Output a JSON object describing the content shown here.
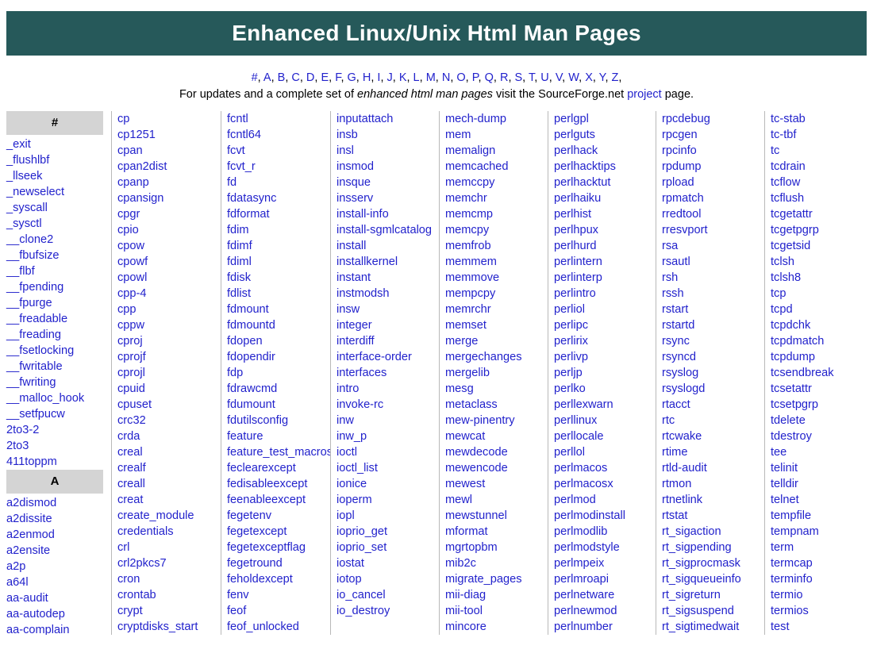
{
  "banner": {
    "title": "Enhanced Linux/Unix Html Man Pages",
    "background_color": "#26595a",
    "text_color": "#ffffff"
  },
  "nav": {
    "separator": ",",
    "link_color": "#2222cc",
    "letters": [
      "#",
      "A",
      "B",
      "C",
      "D",
      "E",
      "F",
      "G",
      "H",
      "I",
      "J",
      "K",
      "L",
      "M",
      "N",
      "O",
      "P",
      "Q",
      "R",
      "S",
      "T",
      "U",
      "V",
      "W",
      "X",
      "Y",
      "Z"
    ]
  },
  "blurb": {
    "part1": "For updates and a complete set of ",
    "emphasis": "enhanced html man pages",
    "part2": " visit the SourceForge.net ",
    "link": "project",
    "part3": " page."
  },
  "index": {
    "header_background": "#d4d4d4",
    "columns": [
      {
        "name": "column-1",
        "blocks": [
          {
            "type": "letter",
            "label": "#"
          },
          {
            "type": "entries",
            "items": [
              "_exit",
              "_flushlbf",
              "_llseek",
              "_newselect",
              "_syscall",
              "_sysctl",
              "__clone2",
              "__fbufsize",
              "__flbf",
              "__fpending",
              "__fpurge",
              "__freadable",
              "__freading",
              "__fsetlocking",
              "__fwritable",
              "__fwriting",
              "__malloc_hook",
              "__setfpucw",
              "2to3-2",
              "2to3",
              "411toppm"
            ]
          },
          {
            "type": "letter",
            "label": "A"
          },
          {
            "type": "entries",
            "items": [
              "a2dismod",
              "a2dissite",
              "a2enmod",
              "a2ensite",
              "a2p",
              "a64l",
              "aa-audit",
              "aa-autodep",
              "aa-complain"
            ]
          }
        ]
      },
      {
        "name": "column-2",
        "blocks": [
          {
            "type": "entries",
            "items": [
              "cp",
              "cp1251",
              "cpan",
              "cpan2dist",
              "cpanp",
              "cpansign",
              "cpgr",
              "cpio",
              "cpow",
              "cpowf",
              "cpowl",
              "cpp-4",
              "cpp",
              "cppw",
              "cproj",
              "cprojf",
              "cprojl",
              "cpuid",
              "cpuset",
              "crc32",
              "crda",
              "creal",
              "crealf",
              "creall",
              "creat",
              "create_module",
              "credentials",
              "crl",
              "crl2pkcs7",
              "cron",
              "crontab",
              "crypt",
              "cryptdisks_start"
            ]
          }
        ]
      },
      {
        "name": "column-3",
        "blocks": [
          {
            "type": "entries",
            "items": [
              "fcntl",
              "fcntl64",
              "fcvt",
              "fcvt_r",
              "fd",
              "fdatasync",
              "fdformat",
              "fdim",
              "fdimf",
              "fdiml",
              "fdisk",
              "fdlist",
              "fdmount",
              "fdmountd",
              "fdopen",
              "fdopendir",
              "fdp",
              "fdrawcmd",
              "fdumount",
              "fdutilsconfig",
              "feature",
              "feature_test_macros",
              "feclearexcept",
              "fedisableexcept",
              "feenableexcept",
              "fegetenv",
              "fegetexcept",
              "fegetexceptflag",
              "fegetround",
              "feholdexcept",
              "fenv",
              "feof",
              "feof_unlocked"
            ]
          }
        ]
      },
      {
        "name": "column-4",
        "blocks": [
          {
            "type": "entries",
            "items": [
              "inputattach",
              "insb",
              "insl",
              "insmod",
              "insque",
              "insserv",
              "install-info",
              "install-sgmlcatalog",
              "install",
              "installkernel",
              "instant",
              "instmodsh",
              "insw",
              "integer",
              "interdiff",
              "interface-order",
              "interfaces",
              "intro",
              "invoke-rc",
              "inw",
              "inw_p",
              "ioctl",
              "ioctl_list",
              "ionice",
              "ioperm",
              "iopl",
              "ioprio_get",
              "ioprio_set",
              "iostat",
              "iotop",
              "io_cancel",
              "io_destroy"
            ]
          }
        ]
      },
      {
        "name": "column-5",
        "blocks": [
          {
            "type": "entries",
            "items": [
              "mech-dump",
              "mem",
              "memalign",
              "memcached",
              "memccpy",
              "memchr",
              "memcmp",
              "memcpy",
              "memfrob",
              "memmem",
              "memmove",
              "mempcpy",
              "memrchr",
              "memset",
              "merge",
              "mergechanges",
              "mergelib",
              "mesg",
              "metaclass",
              "mew-pinentry",
              "mewcat",
              "mewdecode",
              "mewencode",
              "mewest",
              "mewl",
              "mewstunnel",
              "mformat",
              "mgrtopbm",
              "mib2c",
              "migrate_pages",
              "mii-diag",
              "mii-tool",
              "mincore"
            ]
          }
        ]
      },
      {
        "name": "column-6",
        "blocks": [
          {
            "type": "entries",
            "items": [
              "perlgpl",
              "perlguts",
              "perlhack",
              "perlhacktips",
              "perlhacktut",
              "perlhaiku",
              "perlhist",
              "perlhpux",
              "perlhurd",
              "perlintern",
              "perlinterp",
              "perlintro",
              "perliol",
              "perlipc",
              "perlirix",
              "perlivp",
              "perljp",
              "perlko",
              "perllexwarn",
              "perllinux",
              "perllocale",
              "perllol",
              "perlmacos",
              "perlmacosx",
              "perlmod",
              "perlmodinstall",
              "perlmodlib",
              "perlmodstyle",
              "perlmpeix",
              "perlmroapi",
              "perlnetware",
              "perlnewmod",
              "perlnumber"
            ]
          }
        ]
      },
      {
        "name": "column-7",
        "blocks": [
          {
            "type": "entries",
            "items": [
              "rpcdebug",
              "rpcgen",
              "rpcinfo",
              "rpdump",
              "rpload",
              "rpmatch",
              "rredtool",
              "rresvport",
              "rsa",
              "rsautl",
              "rsh",
              "rssh",
              "rstart",
              "rstartd",
              "rsync",
              "rsyncd",
              "rsyslog",
              "rsyslogd",
              "rtacct",
              "rtc",
              "rtcwake",
              "rtime",
              "rtld-audit",
              "rtmon",
              "rtnetlink",
              "rtstat",
              "rt_sigaction",
              "rt_sigpending",
              "rt_sigprocmask",
              "rt_sigqueueinfo",
              "rt_sigreturn",
              "rt_sigsuspend",
              "rt_sigtimedwait"
            ]
          }
        ]
      },
      {
        "name": "column-8",
        "blocks": [
          {
            "type": "entries",
            "items": [
              "tc-stab",
              "tc-tbf",
              "tc",
              "tcdrain",
              "tcflow",
              "tcflush",
              "tcgetattr",
              "tcgetpgrp",
              "tcgetsid",
              "tclsh",
              "tclsh8",
              "tcp",
              "tcpd",
              "tcpdchk",
              "tcpdmatch",
              "tcpdump",
              "tcsendbreak",
              "tcsetattr",
              "tcsetpgrp",
              "tdelete",
              "tdestroy",
              "tee",
              "telinit",
              "telldir",
              "telnet",
              "tempfile",
              "tempnam",
              "term",
              "termcap",
              "terminfo",
              "termio",
              "termios",
              "test"
            ]
          }
        ]
      }
    ]
  }
}
